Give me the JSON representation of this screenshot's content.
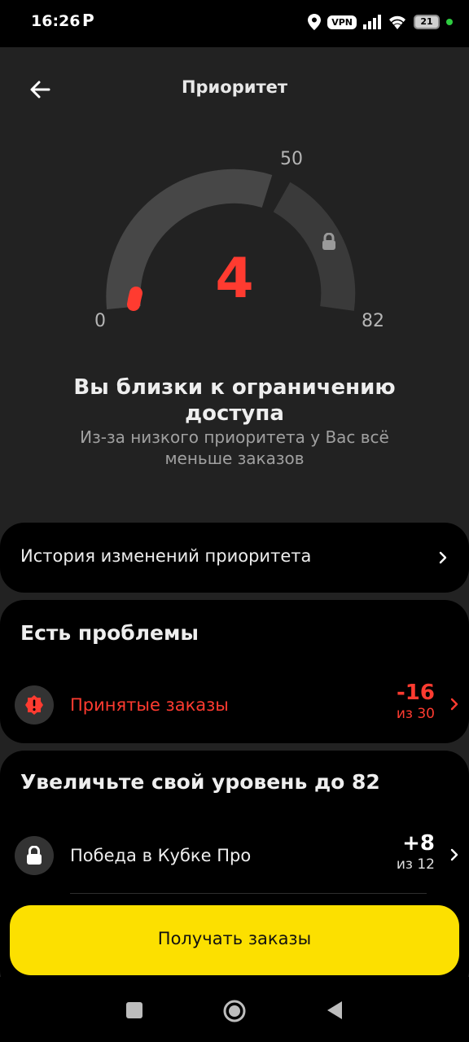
{
  "status": {
    "time": "16:26",
    "app_icon": "P",
    "vpn": "VPN",
    "battery": "21",
    "icons": [
      "location-icon",
      "vpn-icon",
      "signal-icon",
      "wifi-icon",
      "battery-icon"
    ]
  },
  "header": {
    "title": "Приоритет",
    "back_icon": "arrow-left-icon"
  },
  "gauge": {
    "value": "4",
    "min_label": "0",
    "mid_label": "50",
    "max_label": "82",
    "value_number": 4,
    "threshold_number": 50,
    "max_number": 82,
    "value_color": "#ff3b30",
    "track_color": "#474747"
  },
  "message": {
    "title": "Вы близки к ограничению доступа",
    "subtitle": "Из-за низкого приоритета у Вас всё меньше заказов"
  },
  "history": {
    "label": "История изменений приоритета"
  },
  "problems": {
    "heading": "Есть проблемы",
    "items": [
      {
        "label": "Принятые заказы",
        "value": "-16",
        "of": "из 30",
        "color": "#ff3b30",
        "icon": "alert-icon"
      }
    ]
  },
  "increase": {
    "heading": "Увеличьте свой уровень до 82",
    "items": [
      {
        "label": "Победа в Кубке Про",
        "value": "+8",
        "of": "из 12",
        "icon": "lock-icon"
      }
    ]
  },
  "cta": {
    "label": "Получать заказы",
    "color": "#fce000"
  },
  "nav": {
    "icons": [
      "recents-icon",
      "home-icon",
      "back-triangle-icon"
    ]
  }
}
